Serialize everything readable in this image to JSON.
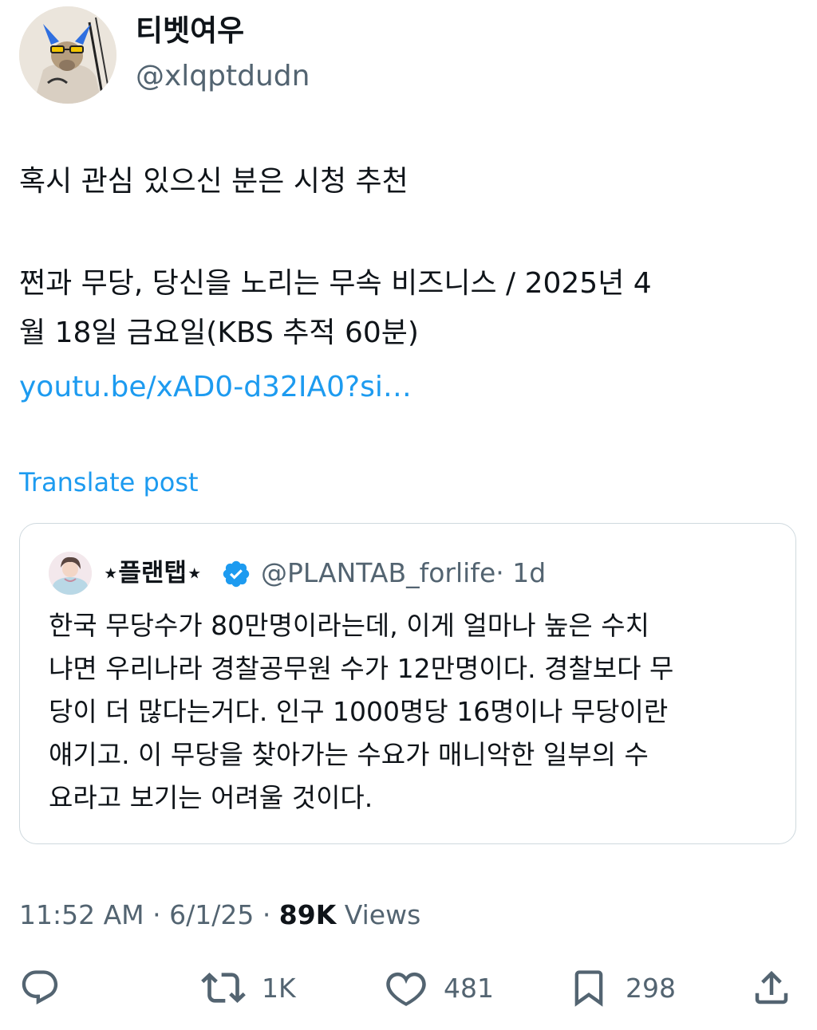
{
  "author": {
    "display_name": "티벳여우",
    "handle": "@xlqptdudn"
  },
  "post": {
    "line1": "혹시 관심 있으신 분은 시청 추천",
    "line2": "쩐과 무당, 당신을 노리는 무속 비즈니스 / 2025년 4",
    "line3": "월 18일 금요일(KBS 추적 60분)",
    "link": "youtu.be/xAD0-d32IA0?si…",
    "translate": "Translate post"
  },
  "quote": {
    "name": "⋆플랜탭⋆",
    "handle": "@PLANTAB_forlife",
    "time": "· 1d",
    "lines": [
      "한국 무당수가 80만명이라는데, 이게 얼마나 높은 수치",
      "냐면 우리나라 경찰공무원 수가 12만명이다. 경찰보다 무",
      "당이 더 많다는거다. 인구 1000명당 16명이나 무당이란",
      "얘기고. 이 무당을 찾아가는 수요가 매니악한 일부의 수",
      "요라고 보기는 어려울 것이다."
    ]
  },
  "meta": {
    "time": "11:52 AM · 6/1/25 · ",
    "views_count": "89K",
    "views_label": " Views"
  },
  "actions": {
    "replies_icon": "reply-icon",
    "retweets": "1K",
    "likes": "481",
    "bookmarks": "298",
    "share_icon": "share-icon"
  },
  "colors": {
    "link": "#1d9bf0",
    "secondary_text": "#536471",
    "verified": "#1d9bf0",
    "border": "#cfd9de"
  }
}
